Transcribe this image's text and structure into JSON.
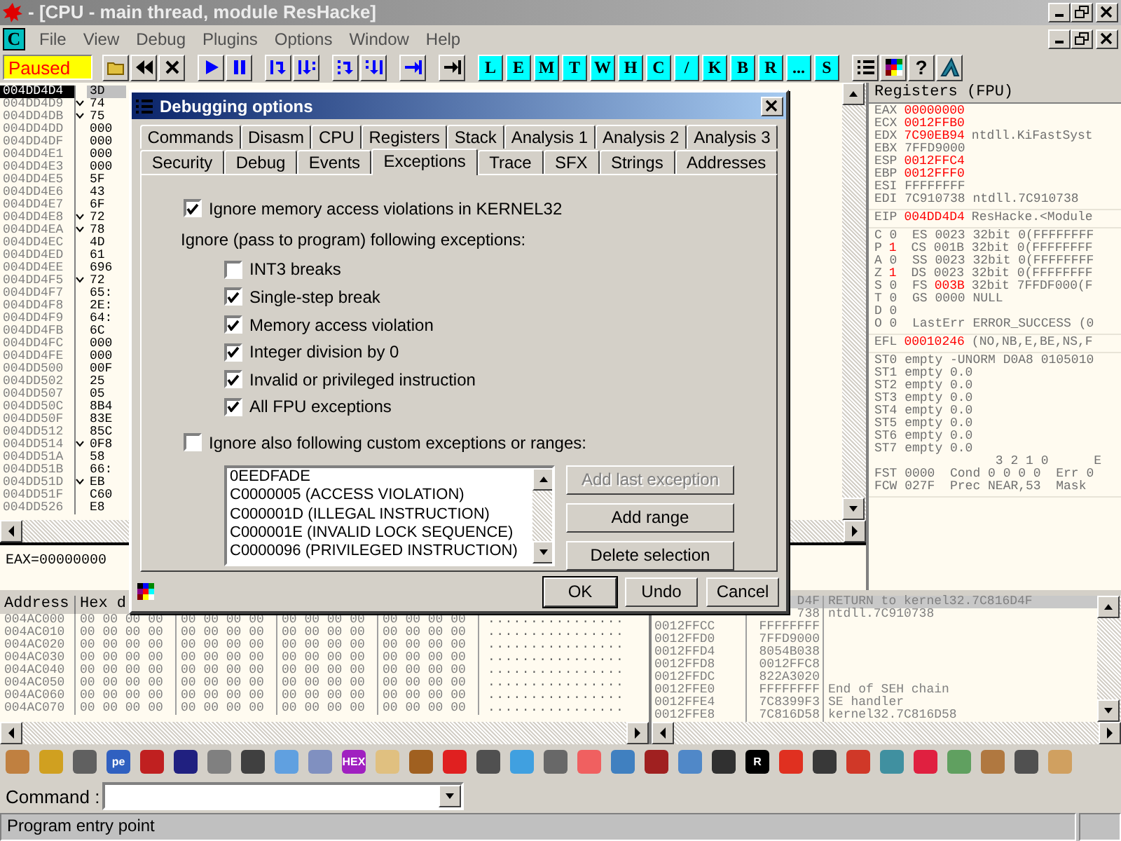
{
  "window": {
    "title": "- [CPU - main thread, module ResHacke]"
  },
  "menu": {
    "app_letter": "C",
    "items": [
      "File",
      "View",
      "Debug",
      "Plugins",
      "Options",
      "Window",
      "Help"
    ]
  },
  "toolbar": {
    "status": "Paused",
    "tools": [
      {
        "kind": "open"
      },
      {
        "kind": "rewind"
      },
      {
        "kind": "close"
      },
      {
        "kind": "run"
      },
      {
        "kind": "pause"
      },
      {
        "kind": "step-into"
      },
      {
        "kind": "step-over"
      },
      {
        "kind": "trace-into"
      },
      {
        "kind": "trace-over"
      },
      {
        "kind": "till-return"
      },
      {
        "kind": "goto"
      }
    ],
    "windows": [
      "L",
      "E",
      "M",
      "T",
      "W",
      "H",
      "C",
      "/",
      "K",
      "B",
      "R",
      "...",
      "S"
    ],
    "extras": [
      {
        "kind": "list"
      },
      {
        "kind": "palette"
      },
      {
        "kind": "help",
        "label": "?"
      },
      {
        "kind": "logo"
      }
    ]
  },
  "disasm": {
    "rows": [
      {
        "address": "004DD4D4",
        "jump": false,
        "hex": "3D",
        "selected": true
      },
      {
        "address": "004DD4D9",
        "jump": true,
        "hex": "74",
        "selected": false
      },
      {
        "address": "004DD4DB",
        "jump": true,
        "hex": "75",
        "selected": false
      },
      {
        "address": "004DD4DD",
        "jump": false,
        "hex": "000",
        "selected": false
      },
      {
        "address": "004DD4DF",
        "jump": false,
        "hex": "000",
        "selected": false
      },
      {
        "address": "004DD4E1",
        "jump": false,
        "hex": "000",
        "selected": false
      },
      {
        "address": "004DD4E3",
        "jump": false,
        "hex": "000",
        "selected": false
      },
      {
        "address": "004DD4E5",
        "jump": false,
        "hex": "5F",
        "selected": false
      },
      {
        "address": "004DD4E6",
        "jump": false,
        "hex": "43",
        "selected": false
      },
      {
        "address": "004DD4E7",
        "jump": false,
        "hex": "6F",
        "selected": false
      },
      {
        "address": "004DD4E8",
        "jump": true,
        "hex": "72",
        "selected": false
      },
      {
        "address": "004DD4EA",
        "jump": true,
        "hex": "78",
        "selected": false
      },
      {
        "address": "004DD4EC",
        "jump": false,
        "hex": "4D",
        "selected": false
      },
      {
        "address": "004DD4ED",
        "jump": false,
        "hex": "61",
        "selected": false
      },
      {
        "address": "004DD4EE",
        "jump": false,
        "hex": "696",
        "selected": false
      },
      {
        "address": "004DD4F5",
        "jump": true,
        "hex": "72",
        "selected": false
      },
      {
        "address": "004DD4F7",
        "jump": false,
        "hex": "65:",
        "selected": false
      },
      {
        "address": "004DD4F8",
        "jump": false,
        "hex": "2E:",
        "selected": false
      },
      {
        "address": "004DD4F9",
        "jump": false,
        "hex": "64:",
        "selected": false
      },
      {
        "address": "004DD4FB",
        "jump": false,
        "hex": "6C",
        "selected": false
      },
      {
        "address": "004DD4FC",
        "jump": false,
        "hex": "000",
        "selected": false
      },
      {
        "address": "004DD4FE",
        "jump": false,
        "hex": "000",
        "selected": false
      },
      {
        "address": "004DD500",
        "jump": false,
        "hex": "00F",
        "selected": false
      },
      {
        "address": "004DD502",
        "jump": false,
        "hex": "25",
        "selected": false
      },
      {
        "address": "004DD507",
        "jump": false,
        "hex": "05",
        "selected": false
      },
      {
        "address": "004DD50C",
        "jump": false,
        "hex": "8B4",
        "selected": false
      },
      {
        "address": "004DD50F",
        "jump": false,
        "hex": "83E",
        "selected": false
      },
      {
        "address": "004DD512",
        "jump": false,
        "hex": "85C",
        "selected": false
      },
      {
        "address": "004DD514",
        "jump": true,
        "hex": "0F8",
        "selected": false
      },
      {
        "address": "004DD51A",
        "jump": false,
        "hex": "58",
        "selected": false
      },
      {
        "address": "004DD51B",
        "jump": false,
        "hex": "66:",
        "selected": false
      },
      {
        "address": "004DD51D",
        "jump": true,
        "hex": "EB",
        "selected": false
      },
      {
        "address": "004DD51F",
        "jump": false,
        "hex": "C60",
        "selected": false
      },
      {
        "address": "004DD526",
        "jump": false,
        "hex": "E8",
        "selected": false
      }
    ],
    "info": "EAX=00000000"
  },
  "registers": {
    "title": "Registers (FPU)",
    "groups": [
      [
        {
          "parts": [
            {
              "text": "EAX",
              "changed": false
            },
            {
              "text": "00000000",
              "changed": true
            }
          ]
        },
        {
          "parts": [
            {
              "text": "ECX",
              "changed": false
            },
            {
              "text": "0012FFB0",
              "changed": true
            }
          ]
        },
        {
          "parts": [
            {
              "text": "EDX",
              "changed": false
            },
            {
              "text": "7C90EB94",
              "changed": true
            },
            {
              "text": "ntdll.KiFastSyst",
              "changed": false
            }
          ]
        },
        {
          "parts": [
            {
              "text": "EBX 7FFD9000",
              "changed": false
            }
          ]
        },
        {
          "parts": [
            {
              "text": "ESP",
              "changed": false
            },
            {
              "text": "0012FFC4",
              "changed": true
            }
          ]
        },
        {
          "parts": [
            {
              "text": "EBP",
              "changed": false
            },
            {
              "text": "0012FFF0",
              "changed": true
            }
          ]
        },
        {
          "parts": [
            {
              "text": "ESI FFFFFFFF",
              "changed": false
            }
          ]
        },
        {
          "parts": [
            {
              "text": "EDI 7C910738 ntdll.7C910738",
              "changed": false
            }
          ]
        }
      ],
      [
        {
          "parts": [
            {
              "text": "EIP",
              "changed": false
            },
            {
              "text": "004DD4D4",
              "changed": true
            },
            {
              "text": "ResHacke.<Module",
              "changed": false
            }
          ]
        }
      ],
      [
        {
          "parts": [
            {
              "text": "C 0  ES 0023 32bit 0(FFFFFFFF",
              "changed": false
            }
          ]
        },
        {
          "parts": [
            {
              "text": "P",
              "changed": false
            },
            {
              "text": "1",
              "changed": true
            },
            {
              "text": " CS 001B 32bit 0(FFFFFFFF",
              "changed": false
            }
          ]
        },
        {
          "parts": [
            {
              "text": "A 0  SS 0023 32bit 0(FFFFFFFF",
              "changed": false
            }
          ]
        },
        {
          "parts": [
            {
              "text": "Z",
              "changed": false
            },
            {
              "text": "1",
              "changed": true
            },
            {
              "text": " DS 0023 32bit 0(FFFFFFFF",
              "changed": false
            }
          ]
        },
        {
          "parts": [
            {
              "text": "S 0  FS",
              "changed": false
            },
            {
              "text": "003B",
              "changed": true
            },
            {
              "text": "32bit 7FFDF000(F",
              "changed": false
            }
          ]
        },
        {
          "parts": [
            {
              "text": "T 0  GS 0000 NULL",
              "changed": false
            }
          ]
        },
        {
          "parts": [
            {
              "text": "D 0",
              "changed": false
            }
          ]
        },
        {
          "parts": [
            {
              "text": "O 0  LastErr ERROR_SUCCESS (0",
              "changed": false
            }
          ]
        }
      ],
      [
        {
          "parts": [
            {
              "text": "EFL",
              "changed": false
            },
            {
              "text": "00010246",
              "changed": true
            },
            {
              "text": "(NO,NB,E,BE,NS,F",
              "changed": false
            }
          ]
        }
      ],
      [
        {
          "parts": [
            {
              "text": "ST0 empty -UNORM D0A8 0105010",
              "changed": false
            }
          ]
        },
        {
          "parts": [
            {
              "text": "ST1 empty 0.0",
              "changed": false
            }
          ]
        },
        {
          "parts": [
            {
              "text": "ST2 empty 0.0",
              "changed": false
            }
          ]
        },
        {
          "parts": [
            {
              "text": "ST3 empty 0.0",
              "changed": false
            }
          ]
        },
        {
          "parts": [
            {
              "text": "ST4 empty 0.0",
              "changed": false
            }
          ]
        },
        {
          "parts": [
            {
              "text": "ST5 empty 0.0",
              "changed": false
            }
          ]
        },
        {
          "parts": [
            {
              "text": "ST6 empty 0.0",
              "changed": false
            }
          ]
        },
        {
          "parts": [
            {
              "text": "ST7 empty 0.0",
              "changed": false
            }
          ]
        },
        {
          "parts": [
            {
              "text": "                3 2 1 0      E",
              "changed": false
            }
          ]
        },
        {
          "parts": [
            {
              "text": "FST 0000  Cond 0 0 0 0  Err 0",
              "changed": false
            }
          ]
        },
        {
          "parts": [
            {
              "text": "FCW 027F  Prec NEAR,53  Mask",
              "changed": false
            }
          ]
        }
      ]
    ]
  },
  "dump": {
    "columns": [
      "Address",
      "Hex d"
    ],
    "rows": [
      {
        "address": "004AC000",
        "hex": [
          "00 00 00 00",
          "00 00 00 00",
          "00 00 00 00",
          "00 00 00 00"
        ],
        "ascii": "................"
      },
      {
        "address": "004AC010",
        "hex": [
          "00 00 00 00",
          "00 00 00 00",
          "00 00 00 00",
          "00 00 00 00"
        ],
        "ascii": "................"
      },
      {
        "address": "004AC020",
        "hex": [
          "00 00 00 00",
          "00 00 00 00",
          "00 00 00 00",
          "00 00 00 00"
        ],
        "ascii": "................"
      },
      {
        "address": "004AC030",
        "hex": [
          "00 00 00 00",
          "00 00 00 00",
          "00 00 00 00",
          "00 00 00 00"
        ],
        "ascii": "................"
      },
      {
        "address": "004AC040",
        "hex": [
          "00 00 00 00",
          "00 00 00 00",
          "00 00 00 00",
          "00 00 00 00"
        ],
        "ascii": "................"
      },
      {
        "address": "004AC050",
        "hex": [
          "00 00 00 00",
          "00 00 00 00",
          "00 00 00 00",
          "00 00 00 00"
        ],
        "ascii": "................"
      },
      {
        "address": "004AC060",
        "hex": [
          "00 00 00 00",
          "00 00 00 00",
          "00 00 00 00",
          "00 00 00 00"
        ],
        "ascii": "................"
      },
      {
        "address": "004AC070",
        "hex": [
          "00 00 00 00",
          "00 00 00 00",
          "00 00 00 00",
          "00 00 00 00"
        ],
        "ascii": "................"
      }
    ]
  },
  "stack": {
    "rows": [
      {
        "value": "D4F",
        "comment": "RETURN to kernel32.7C816D4F",
        "selected": true
      },
      {
        "value": "738",
        "comment": "ntdll.7C910738",
        "selected": false
      },
      {
        "address": "0012FFCC",
        "value": "FFFFFFFF",
        "selected": false
      },
      {
        "address": "0012FFD0",
        "value": "7FFD9000",
        "selected": false
      },
      {
        "address": "0012FFD4",
        "value": "8054B038",
        "selected": false
      },
      {
        "address": "0012FFD8",
        "value": "0012FFC8",
        "selected": false
      },
      {
        "address": "0012FFDC",
        "value": "822A3020",
        "selected": false
      },
      {
        "address": "0012FFE0",
        "value": "FFFFFFFF",
        "comment": "End of SEH chain",
        "selected": false
      },
      {
        "address": "0012FFE4",
        "value": "7C8399F3",
        "comment": "SE handler",
        "selected": false
      },
      {
        "address": "0012FFE8",
        "value": "7C816D58",
        "comment": "kernel32.7C816D58",
        "selected": false
      }
    ]
  },
  "dialog": {
    "title": "Debugging options",
    "tab_rows": [
      [
        {
          "label": "Commands",
          "selected": false
        },
        {
          "label": "Disasm",
          "selected": false
        },
        {
          "label": "CPU",
          "selected": false
        },
        {
          "label": "Registers",
          "selected": false
        },
        {
          "label": "Stack",
          "selected": false
        },
        {
          "label": "Analysis 1",
          "selected": false
        },
        {
          "label": "Analysis 2",
          "selected": false
        },
        {
          "label": "Analysis 3",
          "selected": false
        }
      ],
      [
        {
          "label": "Security",
          "selected": false
        },
        {
          "label": "Debug",
          "selected": false
        },
        {
          "label": "Events",
          "selected": false
        },
        {
          "label": "Exceptions",
          "selected": true
        },
        {
          "label": "Trace",
          "selected": false
        },
        {
          "label": "SFX",
          "selected": false
        },
        {
          "label": "Strings",
          "selected": false
        },
        {
          "label": "Addresses",
          "selected": false
        }
      ]
    ],
    "ignore_kernel32": {
      "label": "Ignore memory access violations in KERNEL32",
      "checked": true
    },
    "pass_label": "Ignore (pass to program) following exceptions:",
    "exceptions": [
      {
        "label": "INT3 breaks",
        "checked": false
      },
      {
        "label": "Single-step break",
        "checked": true
      },
      {
        "label": "Memory access violation",
        "checked": true
      },
      {
        "label": "Integer division by 0",
        "checked": true
      },
      {
        "label": "Invalid or privileged instruction",
        "checked": true
      },
      {
        "label": "All FPU exceptions",
        "checked": true
      }
    ],
    "custom": {
      "label": "Ignore also following custom exceptions or ranges:",
      "checked": false
    },
    "custom_list": [
      "0EEDFADE",
      "C0000005 (ACCESS VIOLATION)",
      "C000001D (ILLEGAL INSTRUCTION)",
      "C000001E (INVALID LOCK SEQUENCE)",
      "C0000096 (PRIVILEGED INSTRUCTION)"
    ],
    "side_buttons": [
      {
        "label": "Add last exception",
        "disabled": true
      },
      {
        "label": "Add range",
        "disabled": false
      },
      {
        "label": "Delete selection",
        "disabled": false
      }
    ],
    "buttons": [
      {
        "label": "OK",
        "default": true
      },
      {
        "label": "Undo",
        "default": false
      },
      {
        "label": "Cancel",
        "default": false
      }
    ]
  },
  "plugin_toolbar": {
    "icons": [
      {
        "color": "#c08040"
      },
      {
        "color": "#d0a020"
      },
      {
        "color": "#606060"
      },
      {
        "color": "#3060c0",
        "label": "pe"
      },
      {
        "color": "#c02020"
      },
      {
        "color": "#202080"
      },
      {
        "color": "#808080"
      },
      {
        "color": "#404040"
      },
      {
        "color": "#60a0e0"
      },
      {
        "color": "#8090c0"
      },
      {
        "color": "#a020c0",
        "label": "HEX"
      },
      {
        "color": "#e0c080"
      },
      {
        "color": "#a06020"
      },
      {
        "color": "#e02020"
      },
      {
        "color": "#505050"
      },
      {
        "color": "#40a0e0"
      },
      {
        "color": "#686868"
      },
      {
        "color": "#f06060"
      },
      {
        "color": "#4080c0"
      },
      {
        "color": "#a02020"
      },
      {
        "color": "#5088c8"
      },
      {
        "color": "#303030"
      },
      {
        "color": "#000000",
        "label": "R"
      },
      {
        "color": "#e03020"
      },
      {
        "color": "#383838"
      },
      {
        "color": "#d03828"
      },
      {
        "color": "#4090a0"
      },
      {
        "color": "#e02040"
      },
      {
        "color": "#60a060"
      },
      {
        "color": "#b07840"
      },
      {
        "color": "#505050"
      },
      {
        "color": "#d0a060"
      }
    ]
  },
  "command": {
    "label": "Command :"
  },
  "status_bar": {
    "text": "Program entry point"
  }
}
